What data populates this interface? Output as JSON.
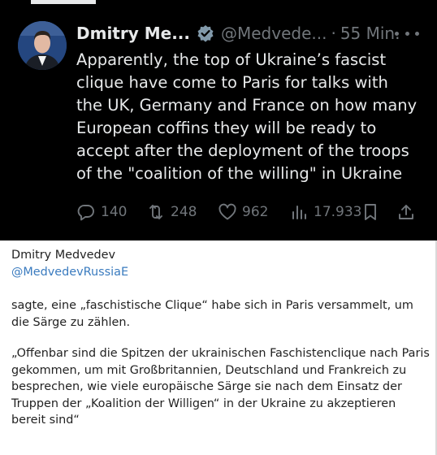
{
  "tweet": {
    "author_name": "Dmitry Me...",
    "author_handle": "@Medvede...",
    "separator": "·",
    "time_ago": "55 Min.",
    "text": "Apparently, the top of Ukraine’s fascist\nclique have come to Paris for talks with\nthe UK, Germany and France on how many\nEuropean coffins they will be ready to\naccept after the deployment of the troops\nof the \"coalition of the willing\" in Ukraine",
    "replies": "140",
    "reposts": "248",
    "likes": "962",
    "views": "17.933",
    "icons": [
      "verified-badge-icon",
      "more-icon",
      "reply-icon",
      "repost-icon",
      "like-icon",
      "views-icon",
      "bookmark-icon",
      "share-icon"
    ]
  },
  "caption": {
    "name": "Dmitry Medvedev",
    "handle": "@MedvedevRussiaE",
    "paragraph1": "sagte, eine „faschistische Clique“ habe sich in Paris versammelt, um die Särge zu zählen.",
    "paragraph2": "„Offenbar sind die Spitzen der ukrainischen Faschistenclique nach Paris gekommen, um mit Großbritannien, Deutschland und Frankreich zu besprechen, wie viele europäische Särge sie nach dem Einsatz der Truppen der „Koalition der Willigen“ in der Ukraine zu akzeptieren bereit sind“"
  },
  "colors": {
    "tweet_background": "#000000",
    "tweet_text": "#e7e9ea",
    "muted": "#71767b",
    "link": "#3a7bbf"
  }
}
